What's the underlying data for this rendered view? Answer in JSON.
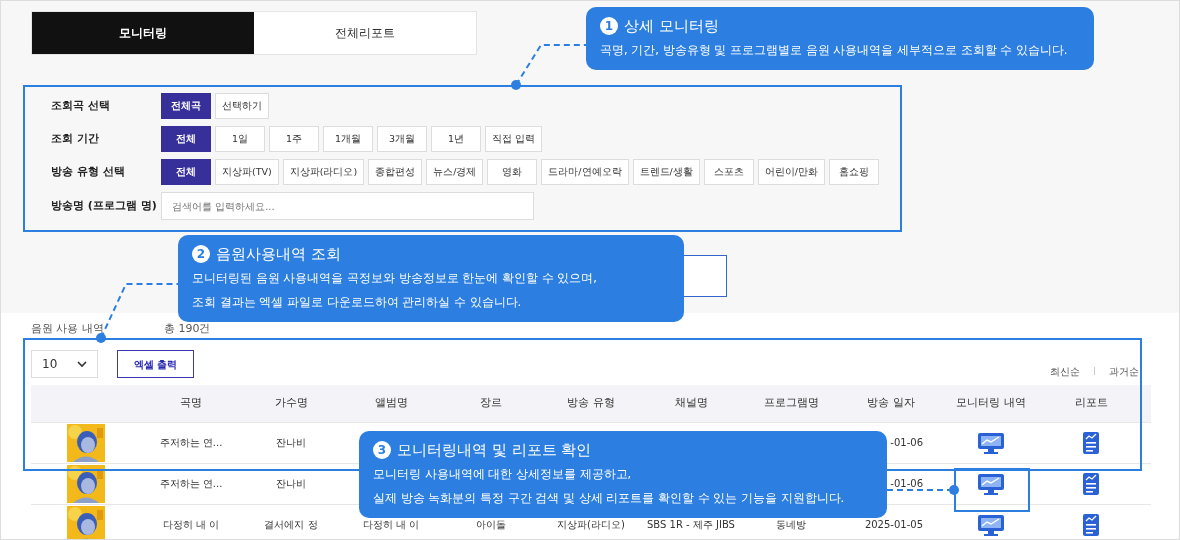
{
  "tabs": [
    {
      "label": "모니터링",
      "selected": true
    },
    {
      "label": "전체리포트",
      "selected": false
    }
  ],
  "filters": [
    {
      "kind": "buttons",
      "label": "조회곡 선택",
      "options": [
        {
          "label": "전체곡",
          "selected": true
        },
        {
          "label": "선택하기",
          "selected": false
        }
      ]
    },
    {
      "kind": "buttons",
      "label": "조회 기간",
      "options": [
        {
          "label": "전체",
          "selected": true
        },
        {
          "label": "1일",
          "selected": false
        },
        {
          "label": "1주",
          "selected": false
        },
        {
          "label": "1개월",
          "selected": false
        },
        {
          "label": "3개월",
          "selected": false
        },
        {
          "label": "1년",
          "selected": false
        },
        {
          "label": "직접 입력",
          "selected": false
        }
      ]
    },
    {
      "kind": "buttons",
      "label": "방송 유형 선택",
      "options": [
        {
          "label": "전체",
          "selected": true
        },
        {
          "label": "지상파(TV)",
          "selected": false
        },
        {
          "label": "지상파(라디오)",
          "selected": false
        },
        {
          "label": "종합편성",
          "selected": false
        },
        {
          "label": "뉴스/경제",
          "selected": false
        },
        {
          "label": "영화",
          "selected": false
        },
        {
          "label": "드라마/연예오락",
          "selected": false
        },
        {
          "label": "트렌드/생활",
          "selected": false
        },
        {
          "label": "스포츠",
          "selected": false
        },
        {
          "label": "어린이/만화",
          "selected": false
        },
        {
          "label": "홈쇼핑",
          "selected": false
        }
      ]
    },
    {
      "kind": "search",
      "label": "방송명 (프로그램 명)",
      "placeholder": "검색어를 입력하세요..."
    }
  ],
  "results": {
    "title": "음원 사용 내역",
    "total": "총 190건",
    "page_size": "10",
    "export_button": "엑셀 출력",
    "sort": [
      "최신순",
      "과거순"
    ]
  },
  "table": {
    "columns": [
      "곡명",
      "가수명",
      "앨범명",
      "장르",
      "방송 유형",
      "채널명",
      "프로그램명",
      "방송 일자",
      "모니터링 내역",
      "리포트"
    ],
    "rows": [
      {
        "kind": "picture",
        "title": "주저하는 연...",
        "artist": "잔나비",
        "date": "-01-06"
      },
      {
        "kind": "picture",
        "title": "주저하는 연...",
        "artist": "잔나비",
        "date": "-01-06"
      },
      {
        "kind": "picture",
        "title": "다정히 내 이",
        "artist": "결서에지 정",
        "album": "다정히 내 이",
        "genre": "아이돌",
        "broadcast_type": "지상파(라디오)",
        "channel": "SBS 1R - 제주 JIBS",
        "program": "동네방",
        "date": "2025-01-05"
      }
    ]
  },
  "callouts": [
    {
      "number": "1",
      "title": "상세 모니터링",
      "lines": [
        "곡명, 기간, 방송유형 및 프로그램별로 음원 사용내역을 세부적으로 조회할 수 있습니다."
      ]
    },
    {
      "number": "2",
      "title": "음원사용내역 조회",
      "lines": [
        "모니터링된 음원 사용내역을 곡정보와 방송정보로 한눈에 확인할 수 있으며,",
        "조회 결과는 엑셀 파일로 다운로드하여 관리하실 수 있습니다."
      ]
    },
    {
      "number": "3",
      "title": "모니터링내역 및 리포트 확인",
      "lines": [
        "모니터링 사용내역에 대한 상세정보를 제공하고,",
        "실제 방송 녹화분의 특정 구간 검색 및 상세 리포트를 확인할 수 있는 기능을 지원합니다."
      ]
    }
  ]
}
